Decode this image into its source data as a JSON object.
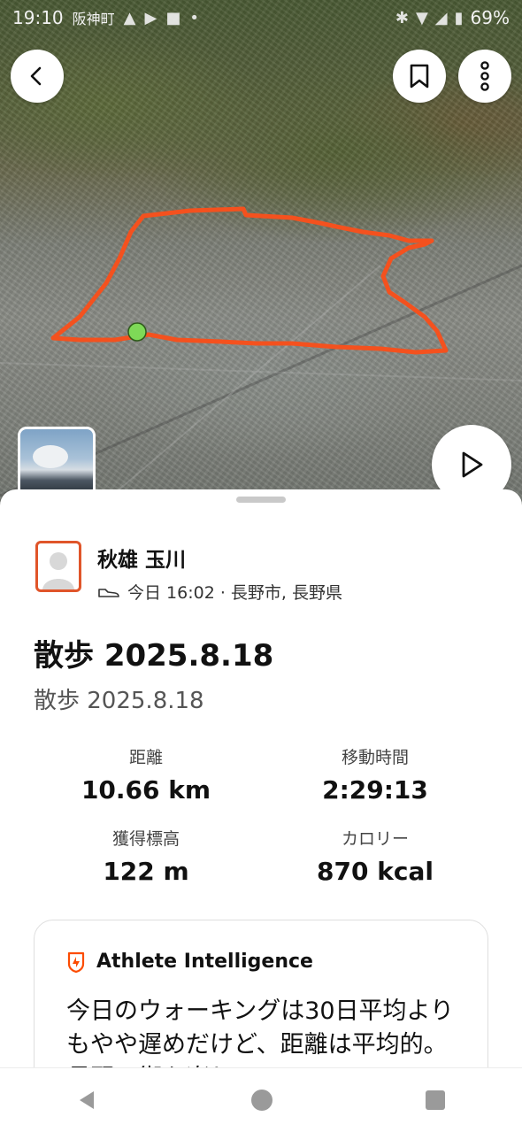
{
  "status_bar": {
    "time": "19:10",
    "location": "阪神町",
    "battery": "69%"
  },
  "map": {
    "route_color": "#f4511e",
    "start_marker_color": "#7ed957"
  },
  "athlete": {
    "name": "秋雄 玉川",
    "meta": "今日 16:02 · 長野市, 長野県"
  },
  "activity": {
    "title": "散歩 2025.8.18",
    "subtitle": "散歩 2025.8.18"
  },
  "stats": {
    "distance": {
      "label": "距離",
      "value": "10.66 km"
    },
    "moving_time": {
      "label": "移動時間",
      "value": "2:29:13"
    },
    "elevation": {
      "label": "獲得標高",
      "value": "122 m"
    },
    "calories": {
      "label": "カロリー",
      "value": "870 kcal"
    }
  },
  "athlete_intelligence": {
    "title": "Athlete Intelligence",
    "text": "今日のウォーキングは30日平均よりもやや遅めだけど、距離は平均的。長野の街を楽し",
    "accent_color": "#fc4c02"
  },
  "icons": {
    "back": "chevron-left-icon",
    "bookmark": "bookmark-icon",
    "more": "more-vertical-icon",
    "play": "play-icon",
    "shoe": "shoe-icon",
    "ai": "athlete-intelligence-icon"
  }
}
